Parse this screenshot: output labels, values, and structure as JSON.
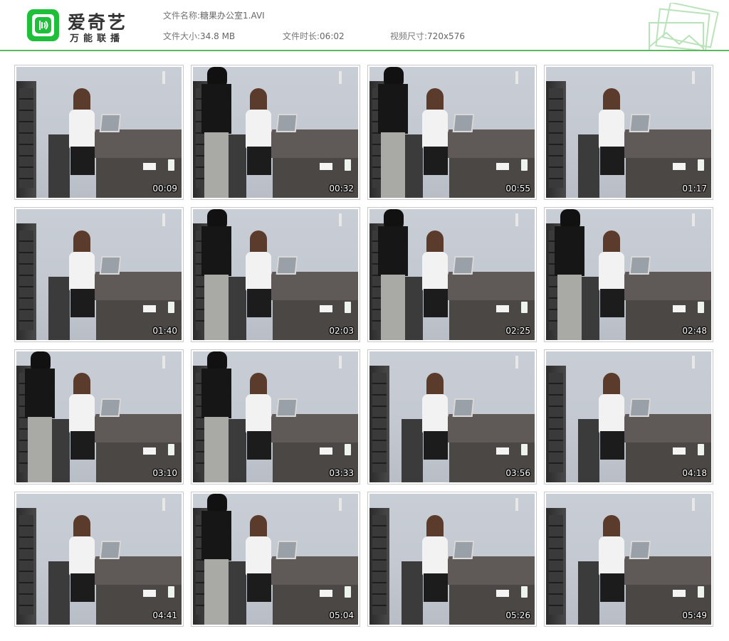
{
  "brand": {
    "name": "爱奇艺",
    "subtitle": "万能联播",
    "logo_icon": "iqiyi-logo-icon",
    "accent": "#1fbf3a"
  },
  "file_info": {
    "name_label": "文件名称:",
    "name_value": "糖果办公室1.AVI",
    "size_label": "文件大小:",
    "size_value": "34.8 MB",
    "duration_label": "文件时长:",
    "duration_value": "06:02",
    "dimensions_label": "视频尺寸:",
    "dimensions_value": "720x576"
  },
  "thumbnails": [
    {
      "time": "00:09",
      "man": false
    },
    {
      "time": "00:32",
      "man": true
    },
    {
      "time": "00:55",
      "man": true
    },
    {
      "time": "01:17",
      "man": false
    },
    {
      "time": "01:40",
      "man": false
    },
    {
      "time": "02:03",
      "man": true
    },
    {
      "time": "02:25",
      "man": true
    },
    {
      "time": "02:48",
      "man": true
    },
    {
      "time": "03:10",
      "man": true
    },
    {
      "time": "03:33",
      "man": true
    },
    {
      "time": "03:56",
      "man": false
    },
    {
      "time": "04:18",
      "man": false
    },
    {
      "time": "04:41",
      "man": false
    },
    {
      "time": "05:04",
      "man": true
    },
    {
      "time": "05:26",
      "man": false
    },
    {
      "time": "05:49",
      "man": false
    }
  ]
}
